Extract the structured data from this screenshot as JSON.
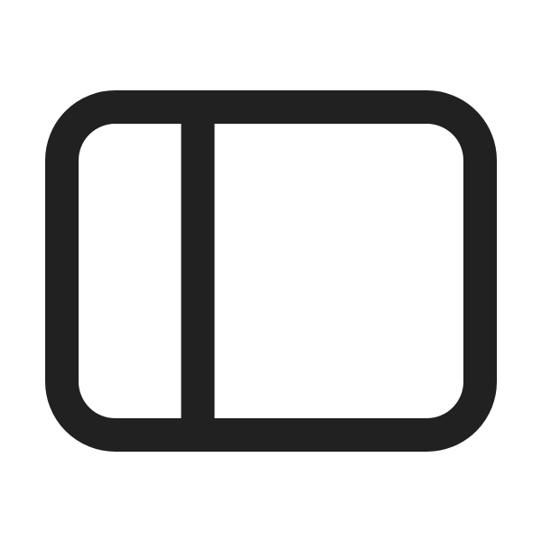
{
  "icon": {
    "name": "sidebar-panel-icon",
    "stroke_color": "#212121",
    "background_color": "#ffffff"
  }
}
